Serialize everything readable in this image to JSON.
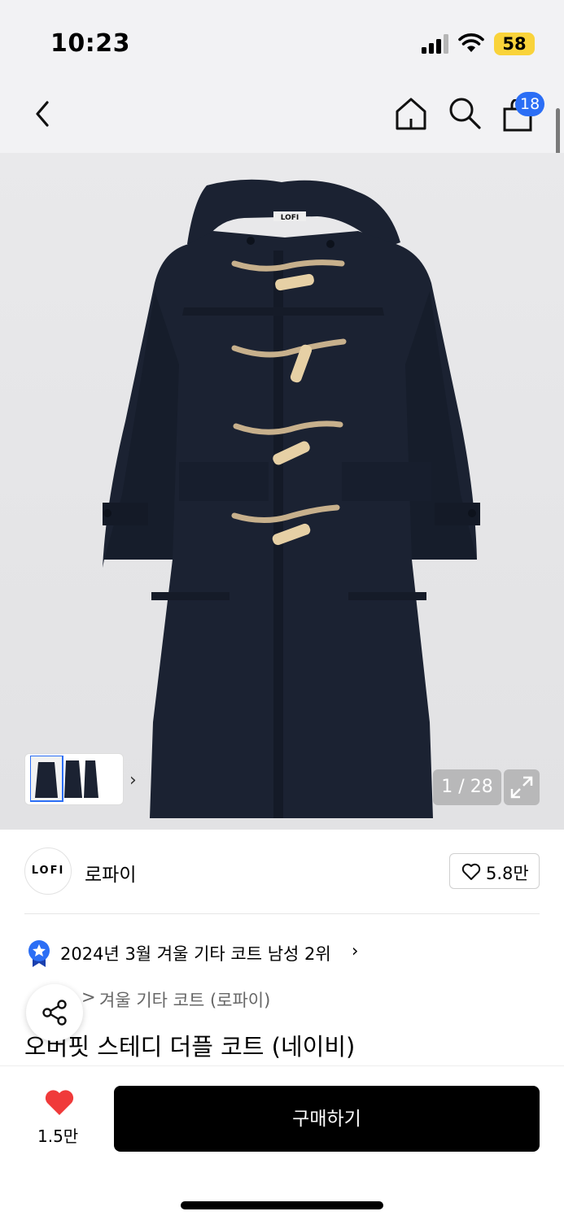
{
  "status_bar": {
    "time": "10:23",
    "battery": "58"
  },
  "nav": {
    "cart_count": "18",
    "icons": [
      "back-icon",
      "home-icon",
      "search-icon",
      "shopping-bag-icon"
    ]
  },
  "gallery": {
    "page_counter": "1 / 28",
    "image_label": "LOFI"
  },
  "brand": {
    "logo_text": "LOFI",
    "name": "로파이",
    "likes": "5.8만"
  },
  "ranking": {
    "text": "2024년 3월 겨울 기타 코트 남성 2위",
    "chevron": "›"
  },
  "product": {
    "category_prefix": ">",
    "category": "겨울 기타 코트 (로파이)",
    "title": "오버핏 스테디 더플 코트 (네이비)"
  },
  "bottom_bar": {
    "wish_count": "1.5만",
    "buy_label": "구매하기"
  },
  "colors": {
    "accent_blue": "#2b6ef5",
    "heart_red": "#f03a3a",
    "battery_yellow": "#f9d33a",
    "coat_navy": "#1b2232"
  }
}
